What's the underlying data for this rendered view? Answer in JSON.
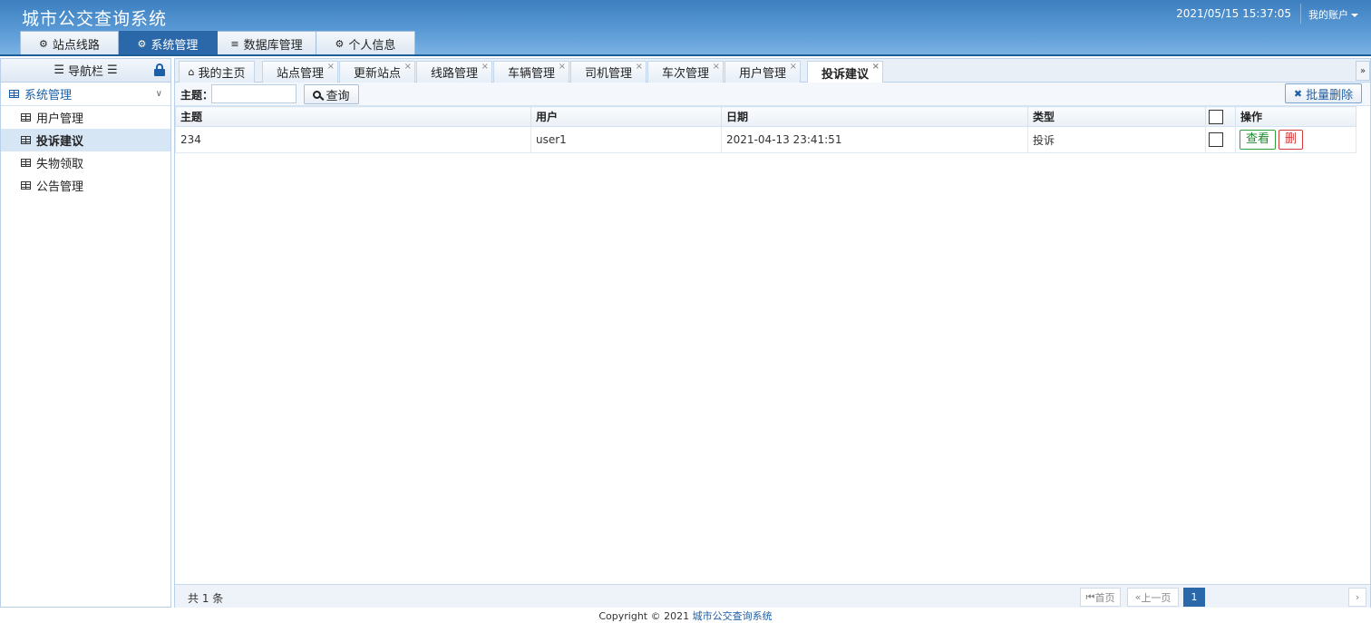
{
  "header": {
    "title": "城市公交查询系统",
    "datetime": "2021/05/15 15:37:05",
    "account": "我的账户"
  },
  "top_nav": [
    {
      "label": "站点线路",
      "icon": "gear-icon"
    },
    {
      "label": "系统管理",
      "icon": "gear-icon",
      "active": true
    },
    {
      "label": "数据库管理",
      "icon": "database-icon"
    },
    {
      "label": "个人信息",
      "icon": "gear-icon"
    }
  ],
  "sidebar": {
    "title": "导航栏",
    "group": "系统管理",
    "items": [
      {
        "label": "用户管理"
      },
      {
        "label": "投诉建议",
        "active": true
      },
      {
        "label": "失物领取"
      },
      {
        "label": "公告管理"
      }
    ]
  },
  "content_tabs": [
    {
      "label": "我的主页"
    },
    {
      "label": "站点管理"
    },
    {
      "label": "更新站点"
    },
    {
      "label": "线路管理"
    },
    {
      "label": "车辆管理"
    },
    {
      "label": "司机管理"
    },
    {
      "label": "车次管理"
    },
    {
      "label": "用户管理"
    },
    {
      "label": "投诉建议",
      "active": true
    }
  ],
  "toolbar": {
    "subject_label": "主题：",
    "subject_value": "",
    "search_label": "查询",
    "batch_delete_label": "批量删除"
  },
  "table": {
    "headers": {
      "subject": "主题",
      "user": "用户",
      "date": "日期",
      "type": "类型",
      "ops": "操作"
    },
    "rows": [
      {
        "subject": "234",
        "user": "user1",
        "date": "2021-04-13 23:41:51",
        "type": "投诉",
        "view_label": "查看",
        "delete_label": "删"
      }
    ]
  },
  "pager": {
    "total": "共 1 条",
    "first": "首页",
    "prev": "上一页",
    "current": "1"
  },
  "footer": {
    "copyright": "Copyright © 2021",
    "link": "城市公交查询系统"
  }
}
